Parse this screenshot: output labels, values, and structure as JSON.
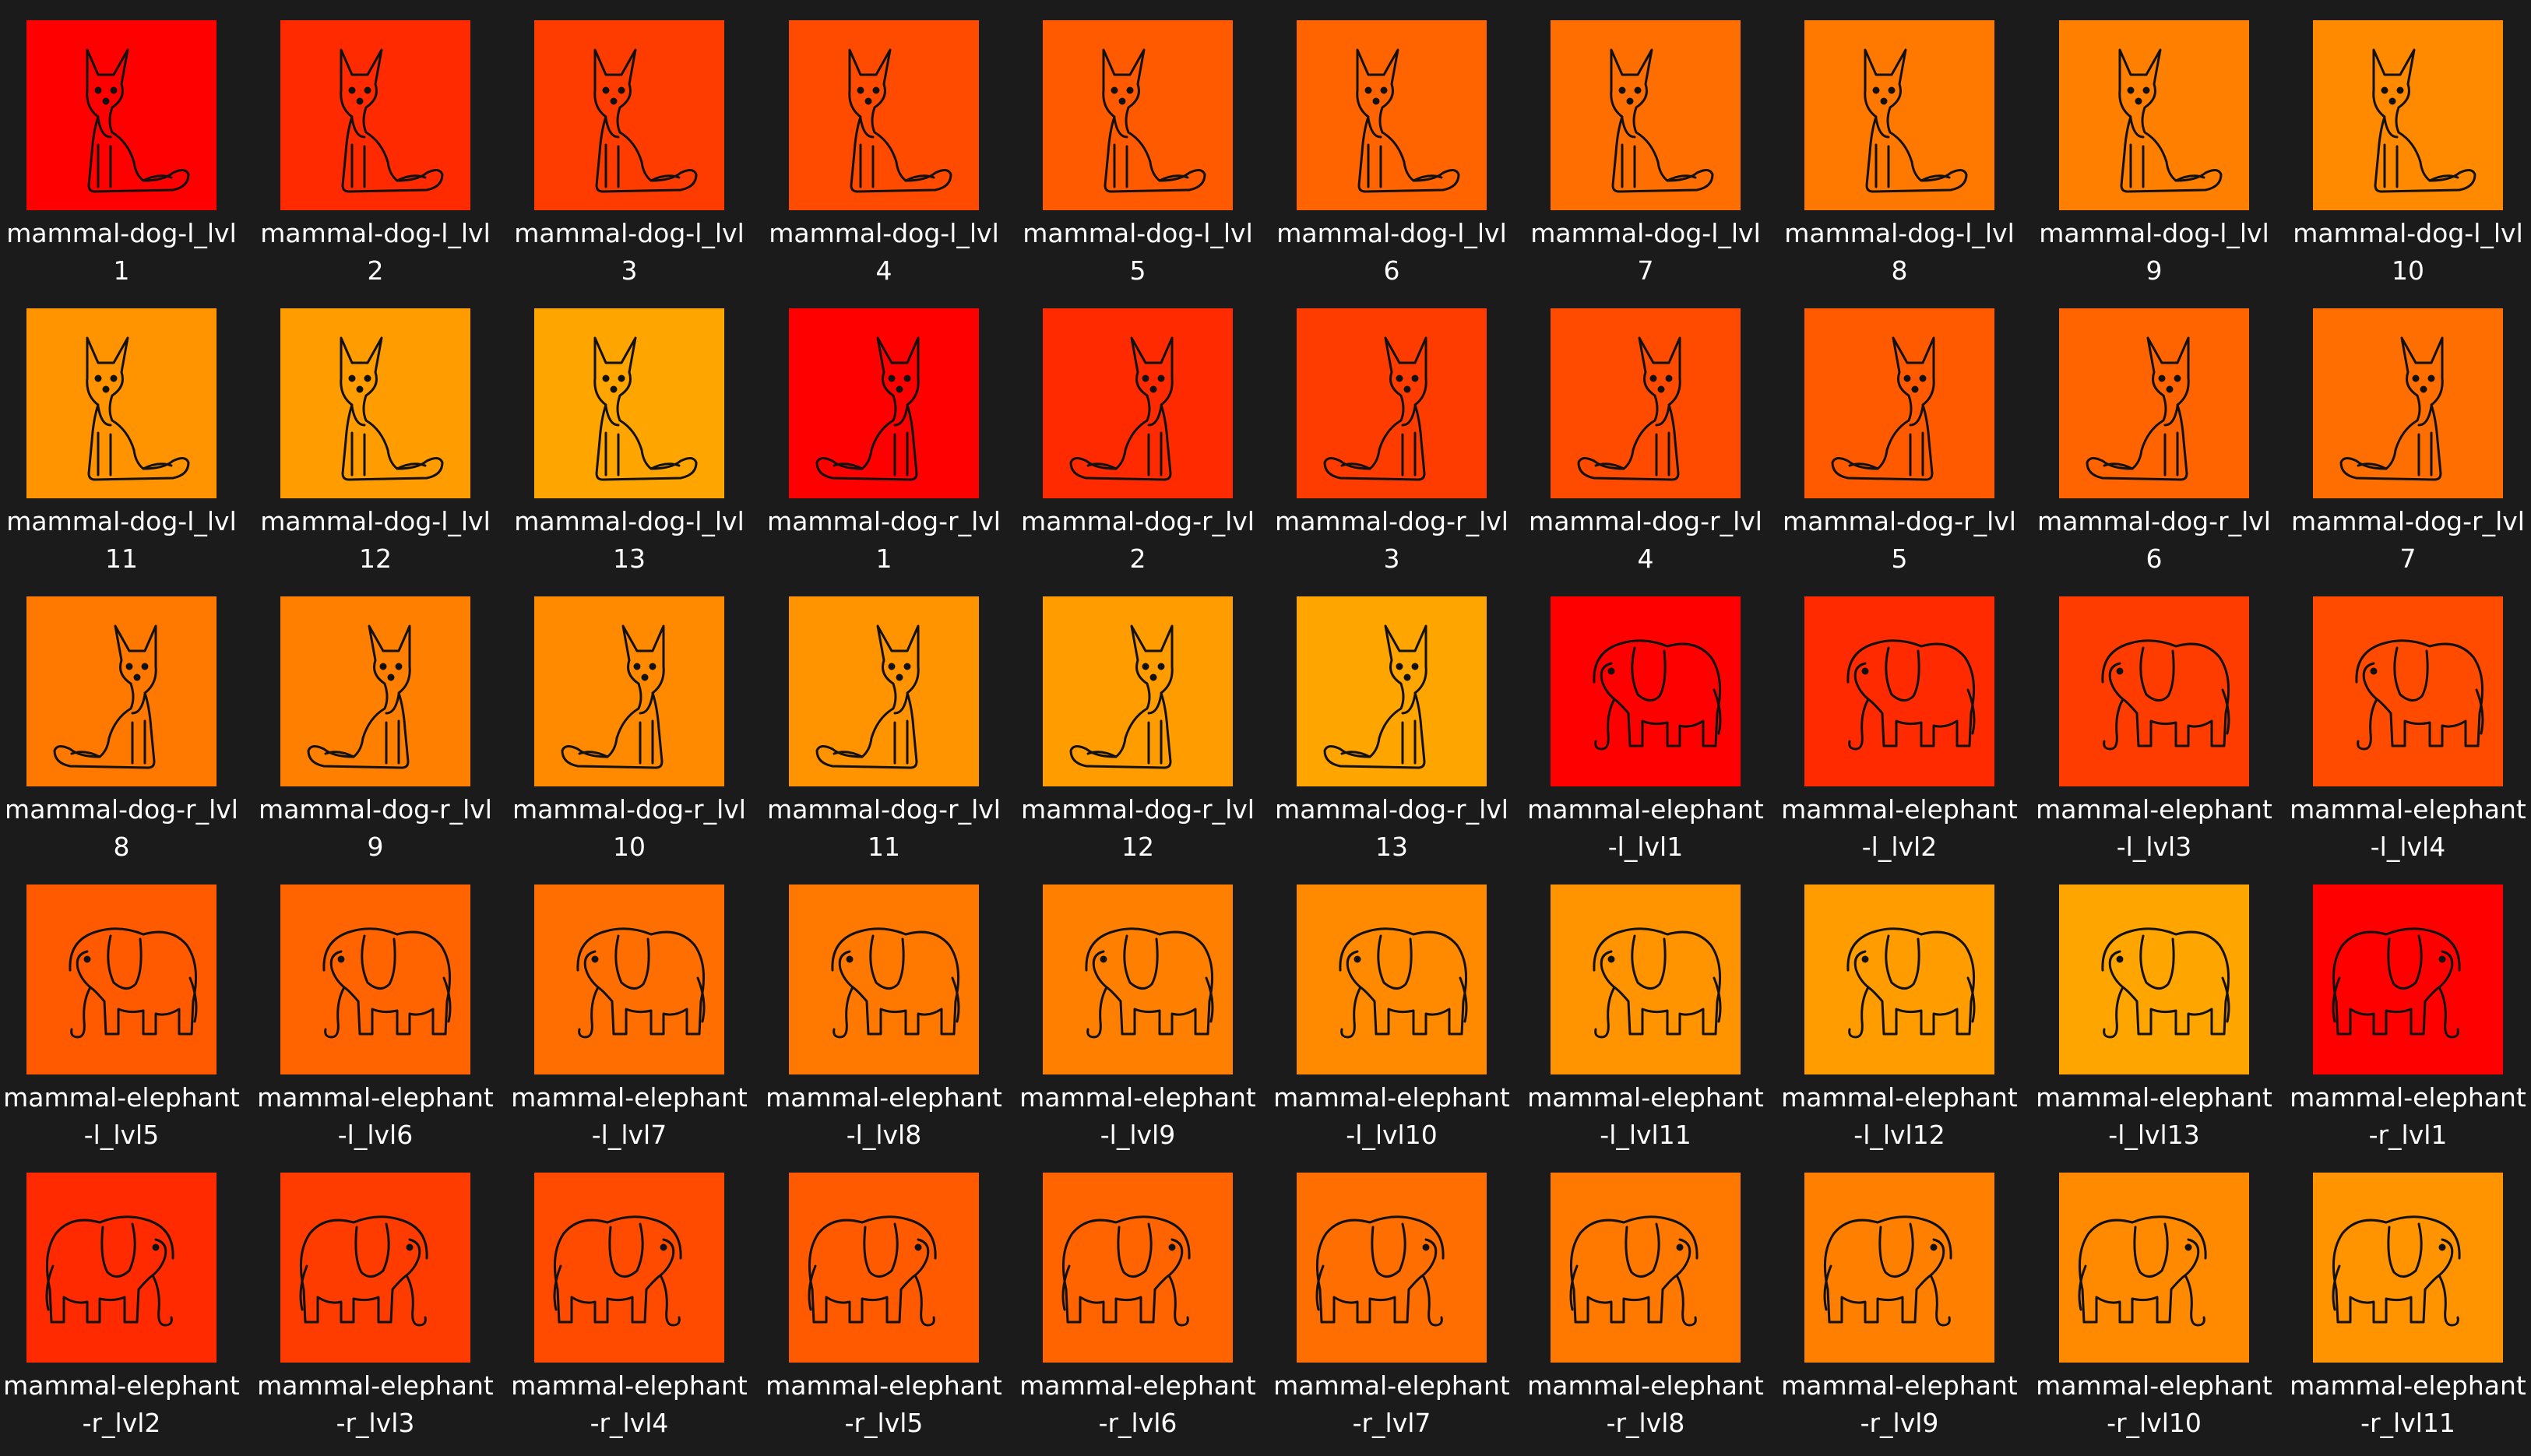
{
  "window": {
    "background": "#1b1b1b"
  },
  "icons": {
    "dog_left": "dog-left-icon",
    "dog_right": "dog-right-icon",
    "elephant_left": "elephant-left-icon",
    "elephant_right": "elephant-right-icon"
  },
  "files": [
    {
      "label": "mammal-dog-l_lvl1",
      "icon": "dog_left",
      "color": "#ff0000"
    },
    {
      "label": "mammal-dog-l_lvl2",
      "icon": "dog_left",
      "color": "#ff2a00"
    },
    {
      "label": "mammal-dog-l_lvl3",
      "icon": "dog_left",
      "color": "#ff3c00"
    },
    {
      "label": "mammal-dog-l_lvl4",
      "icon": "dog_left",
      "color": "#ff4b00"
    },
    {
      "label": "mammal-dog-l_lvl5",
      "icon": "dog_left",
      "color": "#ff5a00"
    },
    {
      "label": "mammal-dog-l_lvl6",
      "icon": "dog_left",
      "color": "#ff6400"
    },
    {
      "label": "mammal-dog-l_lvl7",
      "icon": "dog_left",
      "color": "#ff6e00"
    },
    {
      "label": "mammal-dog-l_lvl8",
      "icon": "dog_left",
      "color": "#ff7800"
    },
    {
      "label": "mammal-dog-l_lvl9",
      "icon": "dog_left",
      "color": "#ff8000"
    },
    {
      "label": "mammal-dog-l_lvl10",
      "icon": "dog_left",
      "color": "#ff8a00"
    },
    {
      "label": "mammal-dog-l_lvl11",
      "icon": "dog_left",
      "color": "#ff9400"
    },
    {
      "label": "mammal-dog-l_lvl12",
      "icon": "dog_left",
      "color": "#ff9c00"
    },
    {
      "label": "mammal-dog-l_lvl13",
      "icon": "dog_left",
      "color": "#ffa500"
    },
    {
      "label": "mammal-dog-r_lvl1",
      "icon": "dog_right",
      "color": "#ff0000"
    },
    {
      "label": "mammal-dog-r_lvl2",
      "icon": "dog_right",
      "color": "#ff2a00"
    },
    {
      "label": "mammal-dog-r_lvl3",
      "icon": "dog_right",
      "color": "#ff3c00"
    },
    {
      "label": "mammal-dog-r_lvl4",
      "icon": "dog_right",
      "color": "#ff4b00"
    },
    {
      "label": "mammal-dog-r_lvl5",
      "icon": "dog_right",
      "color": "#ff5a00"
    },
    {
      "label": "mammal-dog-r_lvl6",
      "icon": "dog_right",
      "color": "#ff6400"
    },
    {
      "label": "mammal-dog-r_lvl7",
      "icon": "dog_right",
      "color": "#ff6e00"
    },
    {
      "label": "mammal-dog-r_lvl8",
      "icon": "dog_right",
      "color": "#ff7800"
    },
    {
      "label": "mammal-dog-r_lvl9",
      "icon": "dog_right",
      "color": "#ff8000"
    },
    {
      "label": "mammal-dog-r_lvl10",
      "icon": "dog_right",
      "color": "#ff8a00"
    },
    {
      "label": "mammal-dog-r_lvl11",
      "icon": "dog_right",
      "color": "#ff9400"
    },
    {
      "label": "mammal-dog-r_lvl12",
      "icon": "dog_right",
      "color": "#ff9c00"
    },
    {
      "label": "mammal-dog-r_lvl13",
      "icon": "dog_right",
      "color": "#ffa500"
    },
    {
      "label": "mammal-elephant-l_lvl1",
      "icon": "elephant_left",
      "color": "#ff0000"
    },
    {
      "label": "mammal-elephant-l_lvl2",
      "icon": "elephant_left",
      "color": "#ff2a00"
    },
    {
      "label": "mammal-elephant-l_lvl3",
      "icon": "elephant_left",
      "color": "#ff3c00"
    },
    {
      "label": "mammal-elephant-l_lvl4",
      "icon": "elephant_left",
      "color": "#ff4b00"
    },
    {
      "label": "mammal-elephant-l_lvl5",
      "icon": "elephant_left",
      "color": "#ff5a00"
    },
    {
      "label": "mammal-elephant-l_lvl6",
      "icon": "elephant_left",
      "color": "#ff6400"
    },
    {
      "label": "mammal-elephant-l_lvl7",
      "icon": "elephant_left",
      "color": "#ff6e00"
    },
    {
      "label": "mammal-elephant-l_lvl8",
      "icon": "elephant_left",
      "color": "#ff7800"
    },
    {
      "label": "mammal-elephant-l_lvl9",
      "icon": "elephant_left",
      "color": "#ff8000"
    },
    {
      "label": "mammal-elephant-l_lvl10",
      "icon": "elephant_left",
      "color": "#ff8a00"
    },
    {
      "label": "mammal-elephant-l_lvl11",
      "icon": "elephant_left",
      "color": "#ff9400"
    },
    {
      "label": "mammal-elephant-l_lvl12",
      "icon": "elephant_left",
      "color": "#ff9c00"
    },
    {
      "label": "mammal-elephant-l_lvl13",
      "icon": "elephant_left",
      "color": "#ffa500"
    },
    {
      "label": "mammal-elephant-r_lvl1",
      "icon": "elephant_right",
      "color": "#ff0000"
    },
    {
      "label": "mammal-elephant-r_lvl2",
      "icon": "elephant_right",
      "color": "#ff2a00"
    },
    {
      "label": "mammal-elephant-r_lvl3",
      "icon": "elephant_right",
      "color": "#ff3c00"
    },
    {
      "label": "mammal-elephant-r_lvl4",
      "icon": "elephant_right",
      "color": "#ff4b00"
    },
    {
      "label": "mammal-elephant-r_lvl5",
      "icon": "elephant_right",
      "color": "#ff5a00"
    },
    {
      "label": "mammal-elephant-r_lvl6",
      "icon": "elephant_right",
      "color": "#ff6400"
    },
    {
      "label": "mammal-elephant-r_lvl7",
      "icon": "elephant_right",
      "color": "#ff6e00"
    },
    {
      "label": "mammal-elephant-r_lvl8",
      "icon": "elephant_right",
      "color": "#ff7800"
    },
    {
      "label": "mammal-elephant-r_lvl9",
      "icon": "elephant_right",
      "color": "#ff8000"
    },
    {
      "label": "mammal-elephant-r_lvl10",
      "icon": "elephant_right",
      "color": "#ff8a00"
    },
    {
      "label": "mammal-elephant-r_lvl11",
      "icon": "elephant_right",
      "color": "#ff9400"
    }
  ]
}
